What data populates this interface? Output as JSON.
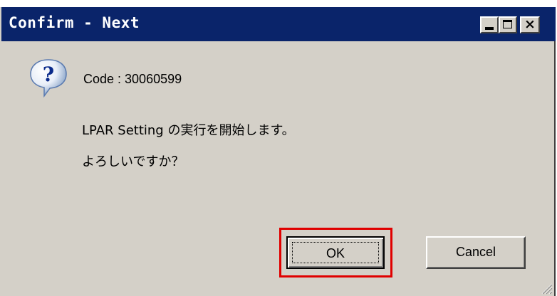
{
  "window": {
    "title": "Confirm - Next",
    "controls": {
      "minimize_icon": "minimize-icon",
      "maximize_icon": "maximize-icon",
      "close_label": "×"
    }
  },
  "dialog": {
    "icon": "question-icon",
    "code": "Code : 30060599",
    "message_line1": "LPAR Setting の実行を開始します。",
    "message_line2": "よろしいですか？"
  },
  "buttons": {
    "ok_label": "OK",
    "cancel_label": "Cancel"
  },
  "colors": {
    "titlebar": "#0a246a",
    "dialog_background": "#d4d0c8",
    "highlight": "#e00000"
  }
}
